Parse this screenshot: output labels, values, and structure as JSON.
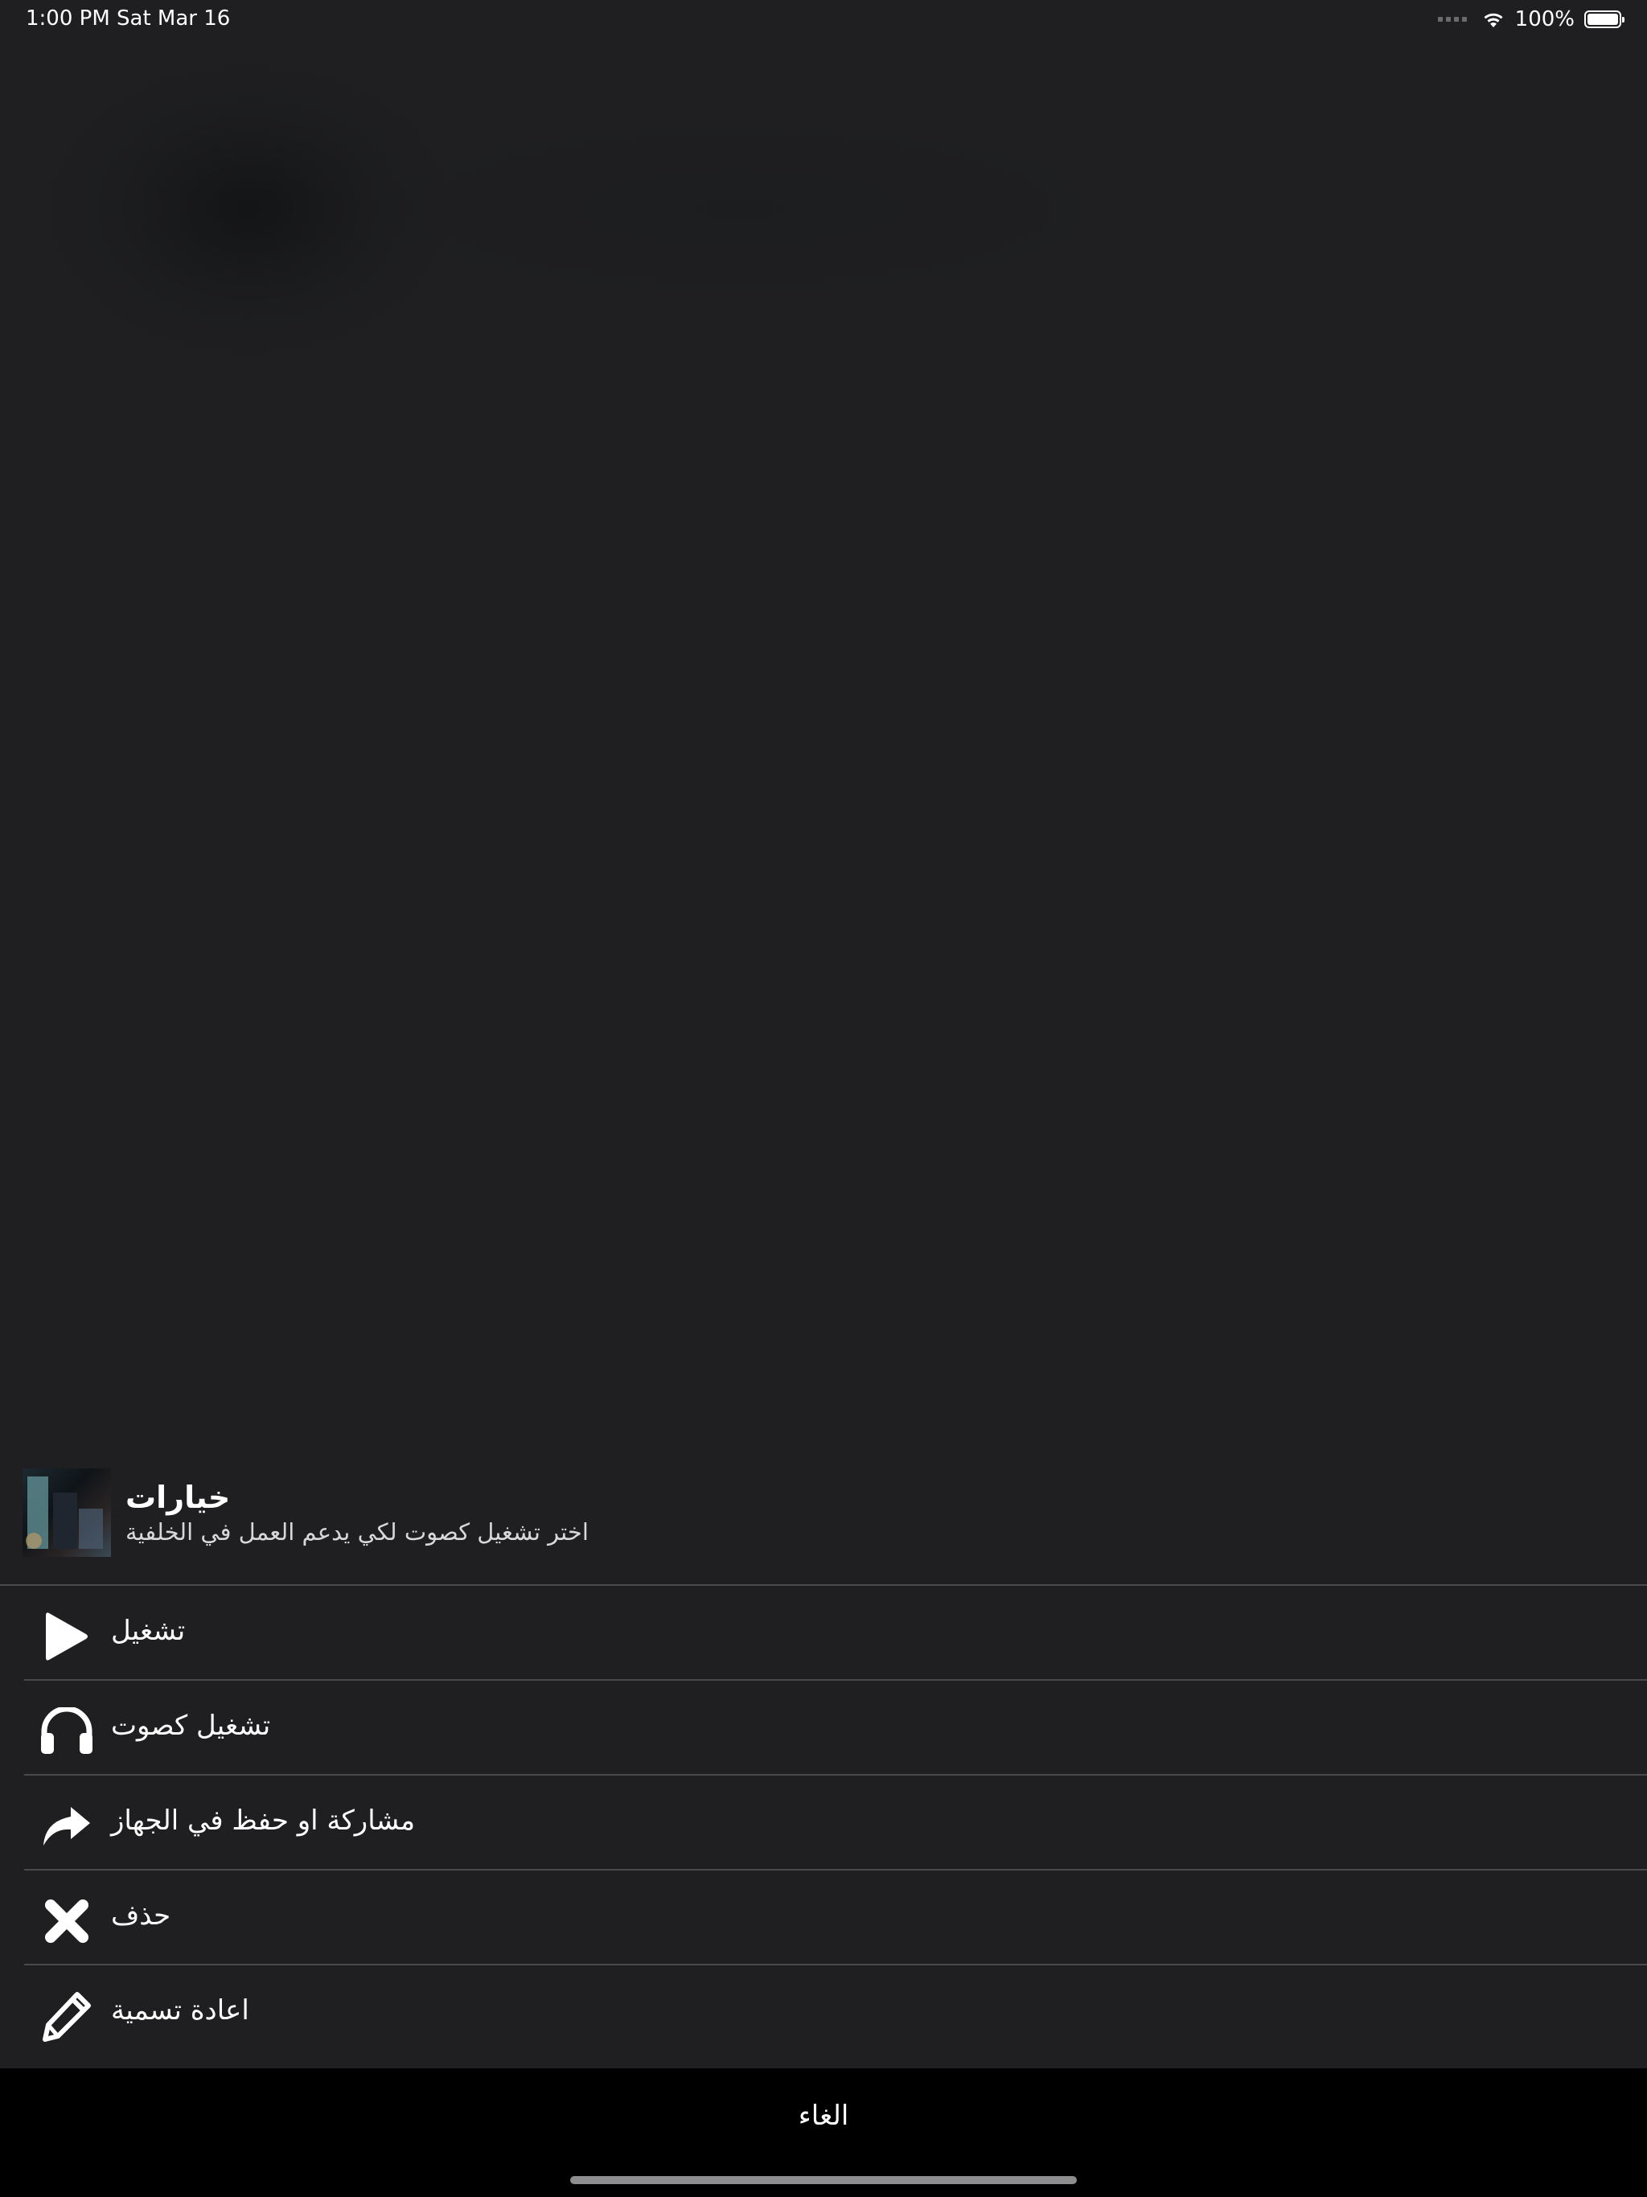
{
  "status_bar": {
    "time": "1:00 PM   Sat Mar 16",
    "battery_text": "100%",
    "battery_level": 1.0
  },
  "sheet": {
    "title": "خيارات",
    "subtitle": "اختر تشغيل كصوت لكي يدعم العمل في الخلفية",
    "items": [
      {
        "label": "تشغيل",
        "icon": "play-icon"
      },
      {
        "label": "تشغيل كصوت",
        "icon": "headphones-icon"
      },
      {
        "label": "مشاركة او حفظ في الجهاز",
        "icon": "share-icon"
      },
      {
        "label": "حذف",
        "icon": "close-icon"
      },
      {
        "label": "اعادة تسمية",
        "icon": "pencil-icon"
      }
    ],
    "cancel_label": "الغاء"
  },
  "colors": {
    "background": "#1f1f21",
    "divider": "#4a4a4c",
    "cancel_background": "#000000",
    "text": "#ffffff"
  }
}
